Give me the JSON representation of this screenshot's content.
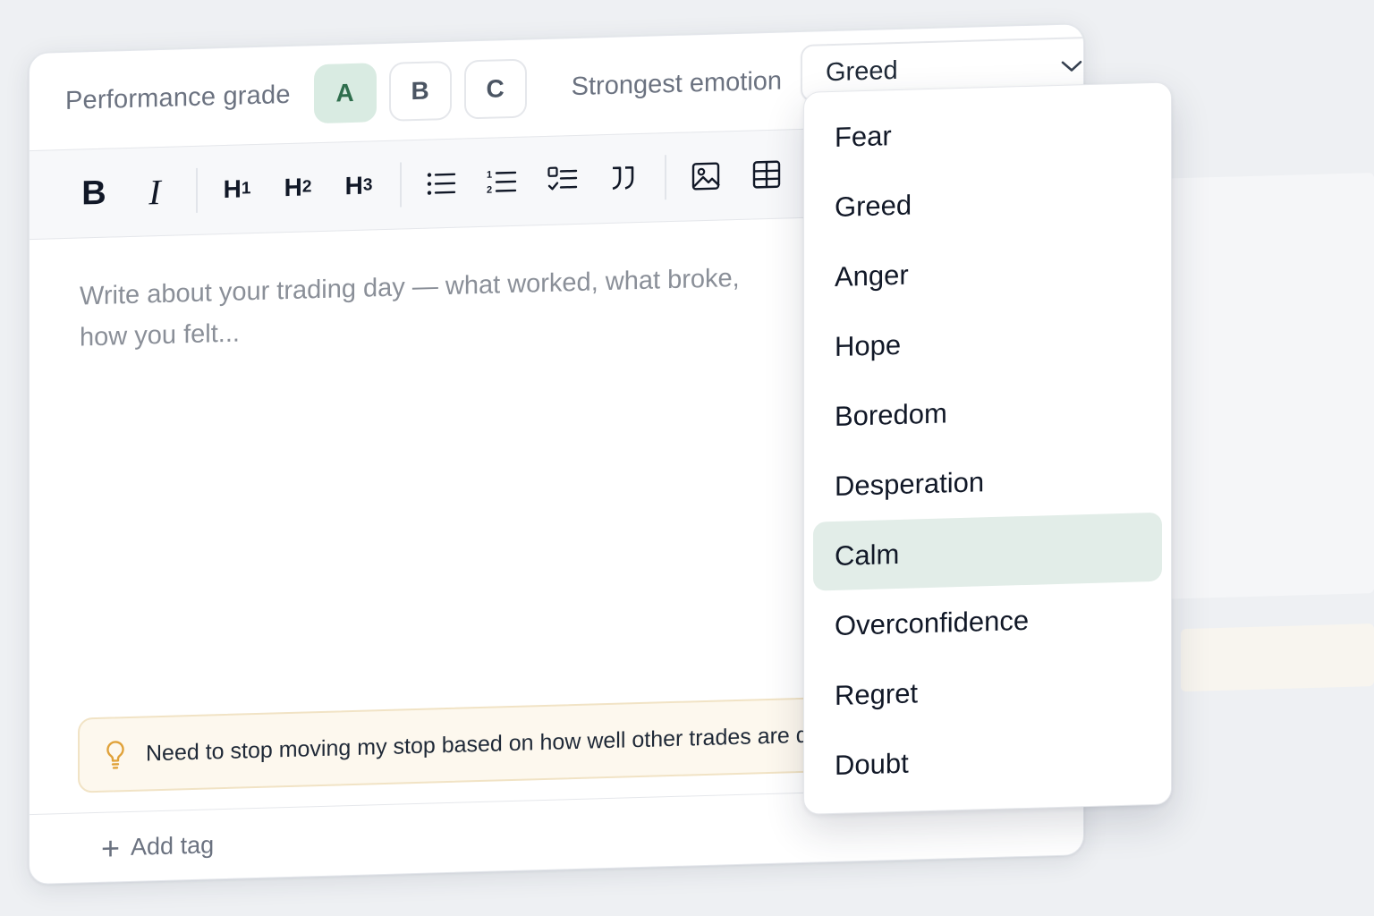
{
  "grade": {
    "label": "Performance grade",
    "options": [
      "A",
      "B",
      "C"
    ],
    "selected": "A"
  },
  "emotion": {
    "label": "Strongest emotion",
    "selected": "Greed",
    "options": [
      "Fear",
      "Greed",
      "Anger",
      "Hope",
      "Boredom",
      "Desperation",
      "Calm",
      "Overconfidence",
      "Regret",
      "Doubt"
    ],
    "highlighted": "Calm"
  },
  "toolbar": {
    "bold": "B",
    "italic": "I",
    "h1": "H",
    "h1_num": "1",
    "h2": "H",
    "h2_num": "2",
    "h3": "H",
    "h3_num": "3",
    "icons": [
      "bullet-list-icon",
      "numbered-list-icon",
      "checklist-icon",
      "quote-icon",
      "image-icon",
      "table-icon"
    ]
  },
  "editor": {
    "placeholder": "Write about your trading day — what worked, what broke, how you felt..."
  },
  "insight": {
    "text": "Need to stop moving my stop based on how well other trades are doing."
  },
  "tags": {
    "add_label": "Add tag"
  },
  "colors": {
    "accent_bg": "#d9ebe2",
    "accent_text": "#2f6e4d",
    "insight_bg": "#fdf8ee",
    "insight_border": "#f1e3c5",
    "bulb": "#e0a23a"
  }
}
